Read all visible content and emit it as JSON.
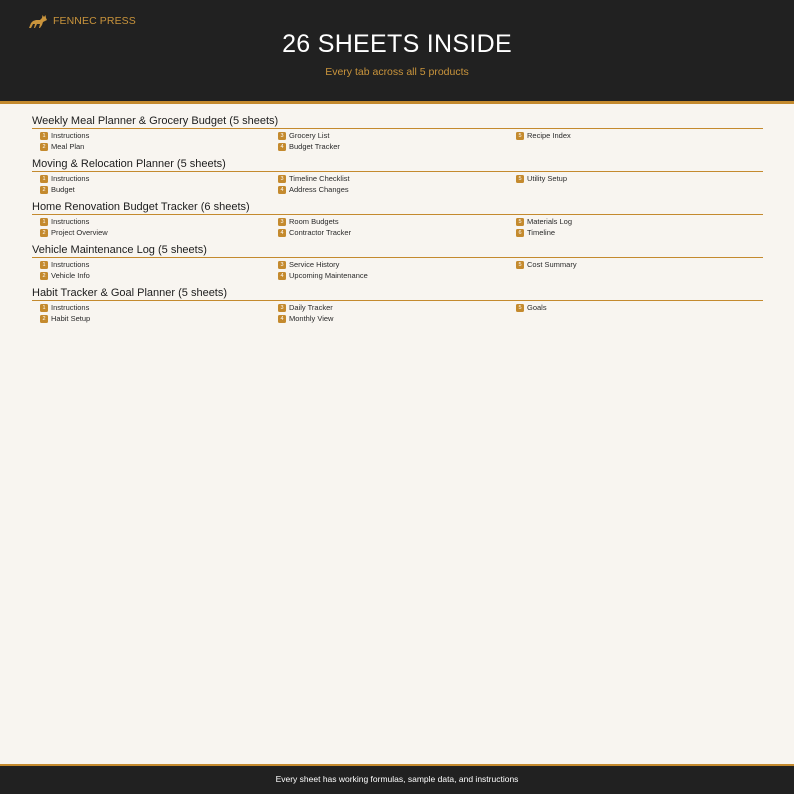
{
  "brand": {
    "name": "FENNEC PRESS",
    "logo_icon": "fox-icon",
    "accent": "#c48a2e"
  },
  "header": {
    "title": "26 SHEETS INSIDE",
    "subtitle": "Every tab across all 5 products"
  },
  "products": [
    {
      "title": "Weekly Meal Planner & Grocery Budget (5 sheets)",
      "sheets": [
        {
          "num": "1",
          "name": "Instructions"
        },
        {
          "num": "2",
          "name": "Meal Plan"
        },
        {
          "num": "3",
          "name": "Grocery List"
        },
        {
          "num": "4",
          "name": "Budget Tracker"
        },
        {
          "num": "5",
          "name": "Recipe Index"
        }
      ]
    },
    {
      "title": "Moving & Relocation Planner (5 sheets)",
      "sheets": [
        {
          "num": "1",
          "name": "Instructions"
        },
        {
          "num": "2",
          "name": "Budget"
        },
        {
          "num": "3",
          "name": "Timeline Checklist"
        },
        {
          "num": "4",
          "name": "Address Changes"
        },
        {
          "num": "5",
          "name": "Utility Setup"
        }
      ]
    },
    {
      "title": "Home Renovation Budget Tracker (6 sheets)",
      "sheets": [
        {
          "num": "1",
          "name": "Instructions"
        },
        {
          "num": "2",
          "name": "Project Overview"
        },
        {
          "num": "3",
          "name": "Room Budgets"
        },
        {
          "num": "4",
          "name": "Contractor Tracker"
        },
        {
          "num": "5",
          "name": "Materials Log"
        },
        {
          "num": "6",
          "name": "Timeline"
        }
      ]
    },
    {
      "title": "Vehicle Maintenance Log (5 sheets)",
      "sheets": [
        {
          "num": "1",
          "name": "Instructions"
        },
        {
          "num": "2",
          "name": "Vehicle Info"
        },
        {
          "num": "3",
          "name": "Service History"
        },
        {
          "num": "4",
          "name": "Upcoming Maintenance"
        },
        {
          "num": "5",
          "name": "Cost Summary"
        }
      ]
    },
    {
      "title": "Habit Tracker & Goal Planner (5 sheets)",
      "sheets": [
        {
          "num": "1",
          "name": "Instructions"
        },
        {
          "num": "2",
          "name": "Habit Setup"
        },
        {
          "num": "3",
          "name": "Daily Tracker"
        },
        {
          "num": "4",
          "name": "Monthly View"
        },
        {
          "num": "5",
          "name": "Goals"
        }
      ]
    }
  ],
  "footer": {
    "text": "Every sheet has working formulas, sample data, and instructions"
  }
}
